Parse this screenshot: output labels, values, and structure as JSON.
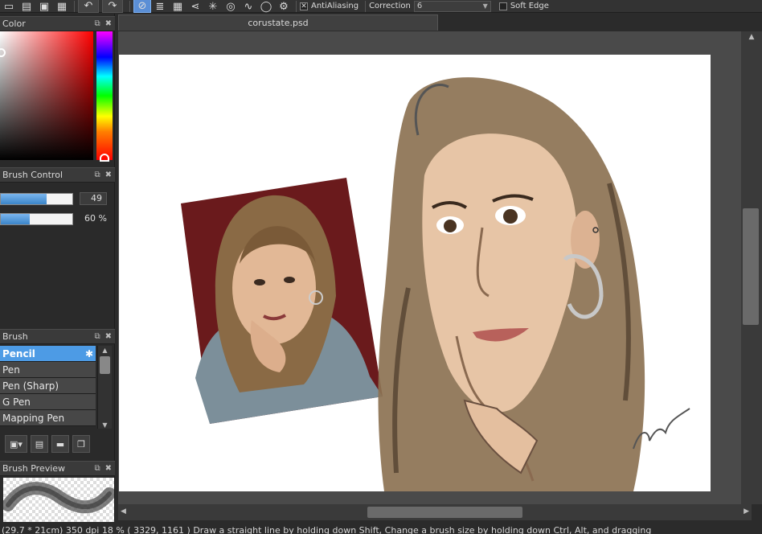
{
  "toolbar": {
    "icons": [
      "new-document-icon",
      "open-icon",
      "save-icon",
      "layers-icon",
      "grid-view-icon",
      "undo-icon",
      "redo-icon",
      "ruler-off-icon",
      "parallel-ruler-icon",
      "grid-ruler-icon",
      "perspective-ruler-icon",
      "radial-ruler-icon",
      "concentric-ruler-icon",
      "curve-ruler-icon",
      "ellipse-ruler-icon",
      "settings-icon"
    ],
    "antialiasing_label": "AntiAliasing",
    "antialiasing_checked": true,
    "correction_label": "Correction",
    "correction_value": "6",
    "soft_edge_label": "Soft Edge",
    "soft_edge_checked": false
  },
  "panels": {
    "color": {
      "title": "Color",
      "hue_color": "#ff0000"
    },
    "brush_control": {
      "title": "Brush Control",
      "size_value": "49",
      "size_fill": 0.64,
      "opacity_value": "60 %",
      "opacity_fill": 0.4
    },
    "brush": {
      "title": "Brush",
      "items": [
        "Pencil",
        "Pen",
        "Pen (Sharp)",
        "G Pen",
        "Mapping Pen"
      ],
      "selected": "Pencil"
    },
    "brush_preview": {
      "title": "Brush Preview"
    }
  },
  "document": {
    "tab_title": "corustate.psd"
  },
  "status": {
    "text": "(29.7 * 21cm)  350 dpi  18 %  ( 3329, 1161 )  Draw a straight line by holding down Shift, Change a brush size by holding down Ctrl, Alt, and dragging"
  },
  "colors": {
    "accent": "#4d9be5",
    "panel_bg": "#2a2a2a",
    "workspace_bg": "#4a4a4a"
  }
}
